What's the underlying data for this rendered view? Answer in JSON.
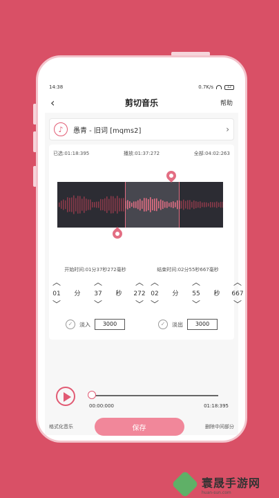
{
  "status": {
    "time": "14:38",
    "net_speed": "0.7K/s",
    "battery": "12"
  },
  "header": {
    "back_label": "‹",
    "title": "剪切音乐",
    "help_label": "帮助"
  },
  "song": {
    "name": "愚青 - 旧词 [mqms2]"
  },
  "times": {
    "selected": "已选:01:18:395",
    "playing": "播放:01:37:272",
    "total": "全部:04:02:263"
  },
  "range": {
    "start_label": "开始时间:01分37秒272毫秒",
    "end_label": "结束时间:02分55秒667毫秒",
    "start": {
      "min": "01",
      "sec": "37",
      "ms": "272"
    },
    "end": {
      "min": "02",
      "sec": "55",
      "ms": "667"
    },
    "unit_min": "分",
    "unit_sec": "秒"
  },
  "fade": {
    "in_label": "淡入",
    "in_value": "3000",
    "out_label": "淡出",
    "out_value": "3000"
  },
  "player": {
    "current": "00:00:000",
    "duration": "01:18:395",
    "progress": 0
  },
  "bottom": {
    "format_label": "格式化音乐",
    "save_label": "保存",
    "delete_label": "删除中间部分"
  },
  "watermark": {
    "main": "寰晟手游网",
    "sub": "huan-sun.com"
  },
  "colors": {
    "background": "#d95066",
    "accent": "#e15a73",
    "save_button": "#f1879a",
    "wave_active": "#e36e83"
  },
  "icons": {
    "back": "back-icon",
    "music": "music-note-icon",
    "chevron": "chevron-right-icon",
    "play": "play-icon",
    "check": "check-circle-icon"
  }
}
